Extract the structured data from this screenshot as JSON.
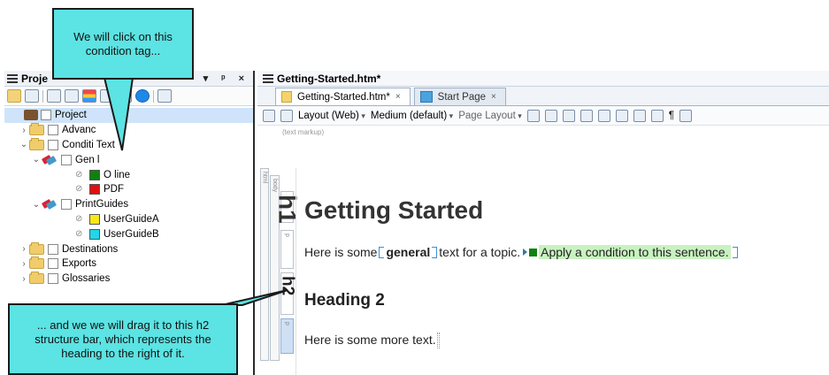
{
  "project_panel": {
    "title": "Proje",
    "controls": "▾ ᵖ ×",
    "tree": [
      {
        "label": "Project",
        "kind": "briefcase",
        "arrow": "",
        "indent": 0,
        "selected": true
      },
      {
        "label": "Advanc",
        "kind": "folder",
        "arrow": "›",
        "indent": 0
      },
      {
        "label": "Conditi      Text",
        "kind": "folder-open",
        "arrow": "⌄",
        "indent": 0
      },
      {
        "label": "Gen   l",
        "kind": "tags",
        "arrow": "⌄",
        "indent": 1
      },
      {
        "label": "O  line",
        "kind": "tag",
        "color": "#108010",
        "indent": 2
      },
      {
        "label": "PDF",
        "kind": "tag",
        "color": "#e01010",
        "indent": 2
      },
      {
        "label": "PrintGuides",
        "kind": "tags",
        "arrow": "⌄",
        "indent": 1
      },
      {
        "label": "UserGuideA",
        "kind": "tag",
        "color": "#f7e81a",
        "indent": 2
      },
      {
        "label": "UserGuideB",
        "kind": "tag",
        "color": "#22d6e8",
        "indent": 2
      },
      {
        "label": "Destinations",
        "kind": "folder",
        "arrow": "›",
        "indent": 0
      },
      {
        "label": "Exports",
        "kind": "folder",
        "arrow": "›",
        "indent": 0
      },
      {
        "label": "Glossaries",
        "kind": "folder",
        "arrow": "›",
        "indent": 0
      }
    ]
  },
  "editor": {
    "doc_title": "Getting-Started.htm*",
    "tabs": [
      {
        "label": "Getting-Started.htm*",
        "close": "×",
        "active": true
      },
      {
        "label": "Start Page",
        "close": "×",
        "active": false
      }
    ],
    "toolbar": {
      "layout": "Layout (Web)",
      "medium": "Medium (default)",
      "page_layout": "Page Layout"
    },
    "text_markup_label": "(text markup)",
    "structure_bars": {
      "html": "html",
      "body": "body",
      "h1": "h1",
      "p1": "p",
      "h2": "h2",
      "p2": "p"
    },
    "content": {
      "heading1": "Getting Started",
      "para_prefix": "Here is some ",
      "para_general": "general",
      "para_mid": " text for a topic. ",
      "para_condition": "Apply a condition to this sentence.",
      "heading2": "Heading 2",
      "para2": "Here is some more text."
    }
  },
  "callouts": {
    "top": "We will click on this condition tag...",
    "bottom": "... and we we will drag it to this h2 structure bar, which represents the heading to the right of it."
  },
  "colors": {
    "callout_bg": "#5ce3e3",
    "condition_highlight": "#c8f2c0",
    "selected_row": "#cfe4fb"
  }
}
